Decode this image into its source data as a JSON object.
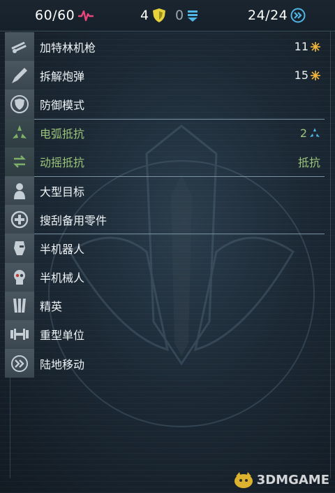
{
  "topbar": {
    "health": "60/60",
    "shield": "4",
    "energy": "0",
    "moves": "24/24"
  },
  "traits": [
    {
      "label": "加特林机枪",
      "value": "11",
      "value_icon": "sun-star-icon",
      "color": "white"
    },
    {
      "label": "拆解炮弹",
      "value": "15",
      "value_icon": "sun-star-icon",
      "color": "white"
    },
    {
      "label": "防御模式",
      "value": "",
      "value_icon": "",
      "color": "white"
    },
    {
      "label": "电弧抵抗",
      "value": "2",
      "value_icon": "arc-triangle-icon",
      "color": "green"
    },
    {
      "label": "动摇抵抗",
      "value": "抵抗",
      "value_icon": "",
      "color": "green"
    },
    {
      "label": "大型目标",
      "value": "",
      "value_icon": "",
      "color": "white"
    },
    {
      "label": "搜刮备用零件",
      "value": "",
      "value_icon": "",
      "color": "white"
    },
    {
      "label": "半机器人",
      "value": "",
      "value_icon": "",
      "color": "white"
    },
    {
      "label": "半机械人",
      "value": "",
      "value_icon": "",
      "color": "white"
    },
    {
      "label": "精英",
      "value": "",
      "value_icon": "",
      "color": "white"
    },
    {
      "label": "重型单位",
      "value": "",
      "value_icon": "",
      "color": "white"
    },
    {
      "label": "陆地移动",
      "value": "",
      "value_icon": "",
      "color": "white"
    }
  ],
  "colors": {
    "accent_green": "#9bc47a",
    "health_pink": "#e8457a",
    "shield_yellow": "#e6d23a",
    "energy_blue": "#4fb6e6",
    "star_gold": "#f0b43a"
  },
  "watermark": {
    "text": "3DMGAME"
  }
}
